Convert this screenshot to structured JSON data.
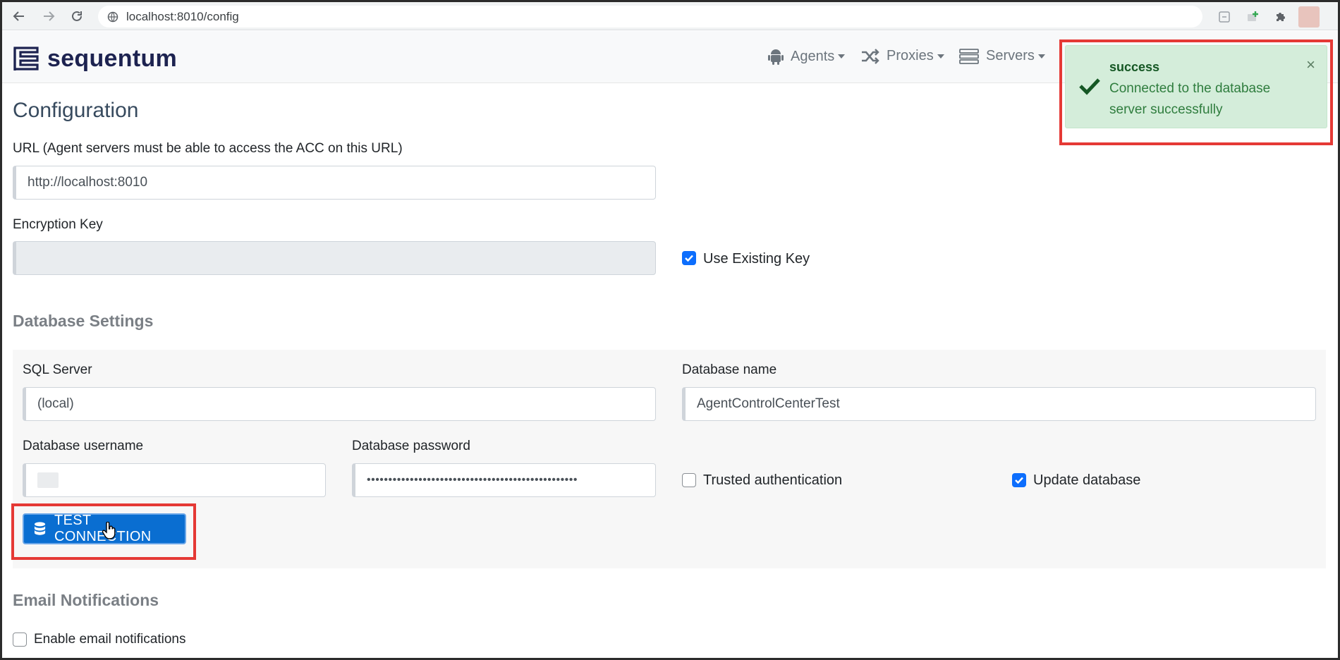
{
  "browser": {
    "url": "localhost:8010/config"
  },
  "navbar": {
    "logo_text": "sequentum",
    "menus": [
      {
        "label": "Agents",
        "icon": "android-icon"
      },
      {
        "label": "Proxies",
        "icon": "shuffle-icon"
      },
      {
        "label": "Servers",
        "icon": "server-icon"
      }
    ]
  },
  "page": {
    "title": "Configuration"
  },
  "form": {
    "url_label": "URL (Agent servers must be able to access the ACC on this URL)",
    "url_value": "http://localhost:8010",
    "encryption_label": "Encryption Key",
    "encryption_value": "",
    "use_existing_key_label": "Use Existing Key",
    "use_existing_key_checked": true
  },
  "database": {
    "section_title": "Database Settings",
    "sql_server_label": "SQL Server",
    "sql_server_value": "(local)",
    "db_name_label": "Database name",
    "db_name_value": "AgentControlCenterTest",
    "username_label": "Database username",
    "username_value": "",
    "password_label": "Database password",
    "password_value": "•••••••••••••••••••••••••••••••••••••••••••••••••",
    "trusted_auth_label": "Trusted authentication",
    "trusted_auth_checked": false,
    "update_db_label": "Update database",
    "update_db_checked": true,
    "test_button_label": "TEST CONNECTION"
  },
  "email": {
    "section_title": "Email Notifications",
    "enable_label": "Enable email notifications",
    "enable_checked": false
  },
  "toast": {
    "title": "success",
    "message": "Connected to the database server successfully",
    "close": "×"
  },
  "colors": {
    "primary": "#0a6ed1",
    "success_bg": "#d4edda",
    "success_text": "#155724",
    "highlight": "#e53935",
    "brand": "#1d2350"
  }
}
